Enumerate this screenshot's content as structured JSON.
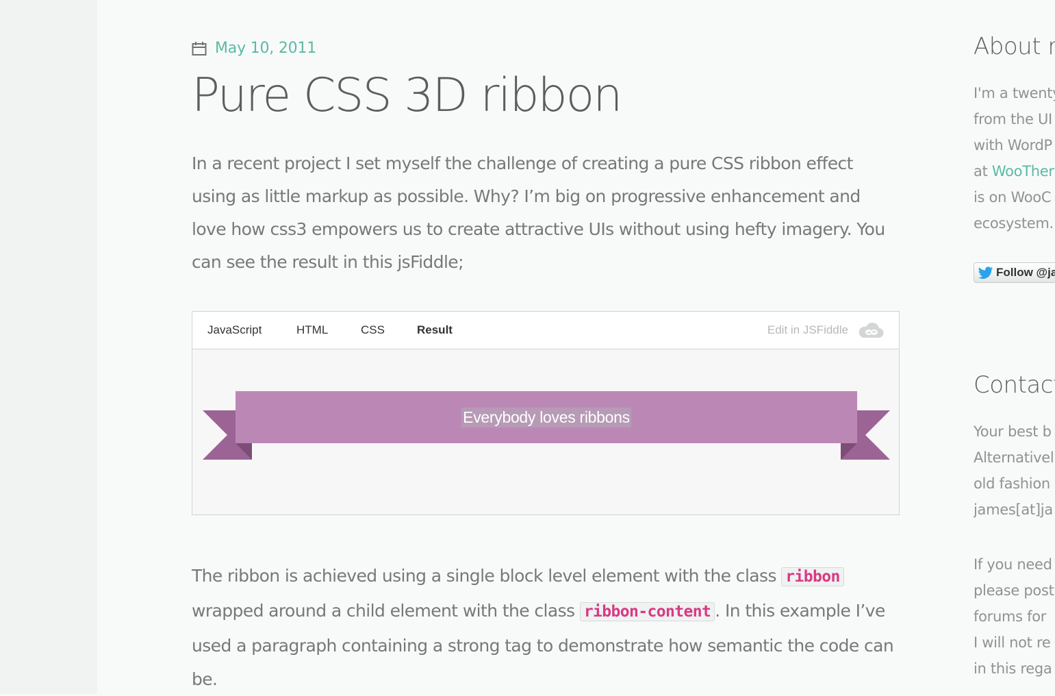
{
  "post": {
    "date": "May 10, 2011",
    "title": "Pure CSS 3D ribbon",
    "intro": "In a recent project I set myself the challenge of creating a pure CSS ribbon effect using as little markup as possible. Why? I’m big on progressive enhancement and love how css3 empowers us to create attractive UIs without using hefty imagery. You can see the result in this jsFiddle;",
    "body_part1": "The ribbon is achieved using a single block level element with the class ",
    "code1": "ribbon",
    "body_part2": " wrapped around a child element with the class ",
    "code2": "ribbon-content",
    "body_part3": ". In this example I’ve used a paragraph containing a strong tag to demonstrate how semantic the code can be."
  },
  "fiddle": {
    "tabs": [
      {
        "label": "JavaScript"
      },
      {
        "label": "HTML"
      },
      {
        "label": "CSS"
      },
      {
        "label": "Result"
      }
    ],
    "active_tab": "Result",
    "edit_label": "Edit in JSFiddle",
    "ribbon_text": "Everybody loves ribbons",
    "colors": {
      "ribbon": "#bb88b6",
      "ribbon_tail": "#9c6395",
      "ribbon_fold": "#7c4e77"
    }
  },
  "sidebar": {
    "about_heading": "About r",
    "about_lines": [
      "I'm a twenty",
      "from the UI",
      "with WordP",
      "is on WooC",
      "ecosystem."
    ],
    "about_link_prefix": "at ",
    "about_link": "WooTher",
    "follow_label": "Follow @ja",
    "contact_heading": "Contact",
    "contact_lines": [
      "Your best b",
      "Alternativel",
      "old fashion",
      "james[at]ja"
    ],
    "support_lines": [
      "If you need",
      "please post",
      "forums for",
      "I will not re",
      "in this rega"
    ]
  },
  "icons": {
    "date": "calendar-icon",
    "edit": "cloud-icon",
    "follow": "twitter-bird-icon"
  },
  "colors": {
    "accent": "#5ab9a4",
    "code_text": "#d73a84"
  }
}
